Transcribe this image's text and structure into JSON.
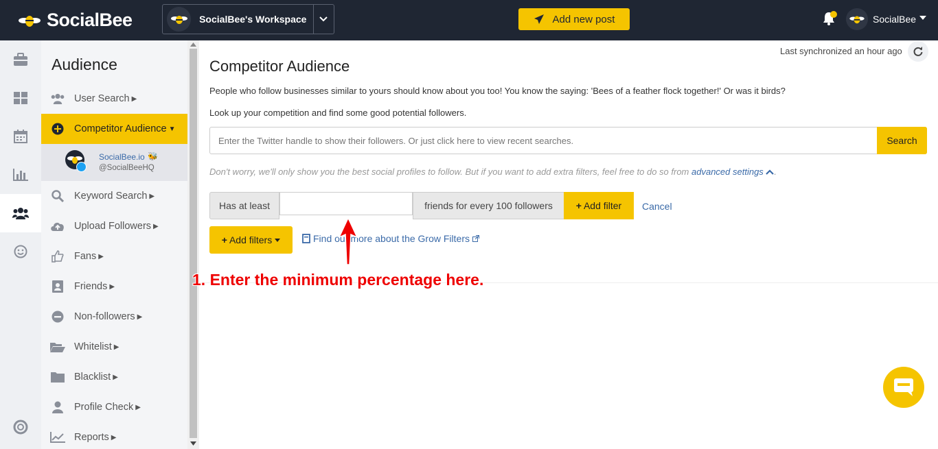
{
  "app": {
    "logo_text": "SocialBee",
    "workspace": "SocialBee's Workspace",
    "add_post_label": "Add new post",
    "user_name": "SocialBee"
  },
  "rail": {
    "icons": [
      "briefcase-icon",
      "dashboard-icon",
      "calendar-icon",
      "analytics-icon",
      "audience-icon",
      "smile-icon",
      "help-icon"
    ],
    "active": "audience-icon"
  },
  "sidebar": {
    "title": "Audience",
    "items": [
      {
        "label": "User Search",
        "icon": "users-icon"
      },
      {
        "label": "Competitor Audience",
        "icon": "plus-circle-icon"
      },
      {
        "label": "Keyword Search",
        "icon": "search-icon"
      },
      {
        "label": "Upload Followers",
        "icon": "cloud-upload-icon"
      },
      {
        "label": "Fans",
        "icon": "thumbs-up-icon"
      },
      {
        "label": "Friends",
        "icon": "contact-icon"
      },
      {
        "label": "Non-followers",
        "icon": "minus-circle-icon"
      },
      {
        "label": "Whitelist",
        "icon": "folder-open-icon"
      },
      {
        "label": "Blacklist",
        "icon": "folder-icon"
      },
      {
        "label": "Profile Check",
        "icon": "user-icon"
      },
      {
        "label": "Reports",
        "icon": "chart-line-icon"
      }
    ],
    "account": {
      "name": "SocialBee.io",
      "handle": "@SocialBeeHQ"
    }
  },
  "main": {
    "sync_text": "Last synchronized an hour ago",
    "title": "Competitor Audience",
    "intro1": "People who follow businesses similar to yours should know about you too! You know the saying: 'Bees of a feather flock together!' Or was it birds?",
    "intro2": "Look up your competition and find some good potential followers.",
    "search_placeholder": "Enter the Twitter handle to show their followers. Or just click here to view recent searches.",
    "search_button": "Search",
    "note_text": "Don't worry, we'll only show you the best social profiles to follow. But if you want to add extra filters, feel free to do so from ",
    "note_link": "advanced settings",
    "filter": {
      "label_before": "Has at least",
      "value": "",
      "label_after": "friends for every 100 followers",
      "add_label": "Add filter",
      "cancel_label": "Cancel"
    },
    "add_filters_label": "Add filters",
    "grow_link": "Find out more about the Grow Filters"
  },
  "annotation": {
    "text": "1. Enter the minimum percentage here."
  },
  "colors": {
    "accent": "#f5c400",
    "topbar": "#1f2633",
    "link": "#3a6aa8",
    "annotation": "#e00000"
  }
}
